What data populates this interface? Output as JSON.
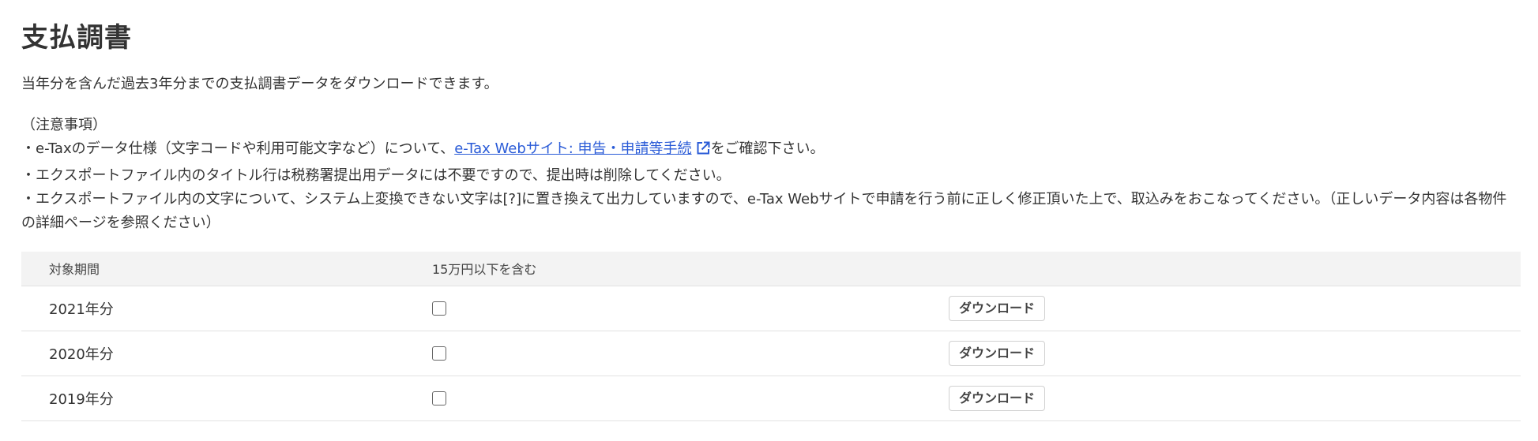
{
  "page": {
    "title": "支払調書",
    "intro": "当年分を含んだ過去3年分までの支払調書データをダウンロードできます。"
  },
  "notes": {
    "heading": "（注意事項）",
    "line1_prefix": "・e-Taxのデータ仕様（文字コードや利用可能文字など）について、",
    "line1_link": "e-Tax Webサイト: 申告・申請等手続",
    "line1_suffix": "をご確認下さい。",
    "line2": "・エクスポートファイル内のタイトル行は税務署提出用データには不要ですので、提出時は削除してください。",
    "line3": "・エクスポートファイル内の文字について、システム上変換できない文字は[?]に置き換えて出力していますので、e-Tax Webサイトで申請を行う前に正しく修正頂いた上で、取込みをおこなってください。（正しいデータ内容は各物件の詳細ページを参照ください）"
  },
  "table": {
    "headers": [
      "対象期間",
      "15万円以下を含む",
      ""
    ],
    "rows": [
      {
        "period": "2021年分",
        "include_small": false,
        "button": "ダウンロード"
      },
      {
        "period": "2020年分",
        "include_small": false,
        "button": "ダウンロード"
      },
      {
        "period": "2019年分",
        "include_small": false,
        "button": "ダウンロード"
      }
    ]
  },
  "colors": {
    "link": "#2a5bd7",
    "header_bg": "#f3f3f3"
  },
  "icons": {
    "external_link": "external-link-icon"
  }
}
